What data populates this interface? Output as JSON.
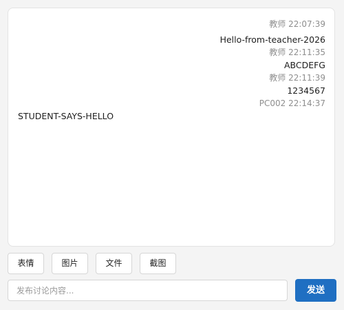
{
  "messages": [
    {
      "sender": "教师",
      "time": "22:07:39",
      "text": "Hello-from-teacher-2026"
    },
    {
      "sender": "教师",
      "time": "22:11:35",
      "text": "ABCDEFG"
    },
    {
      "sender": "教师",
      "time": "22:11:39",
      "text": "1234567"
    },
    {
      "sender": "PC002",
      "time": "22:14:37",
      "text": "STUDENT-SAYS-HELLO"
    }
  ],
  "toolbar": {
    "emoji_label": "表情",
    "image_label": "图片",
    "file_label": "文件",
    "screenshot_label": "截图"
  },
  "composer": {
    "placeholder": "发布讨论内容...",
    "value": "",
    "send_label": "发送"
  },
  "colors": {
    "send_button": "#1f6fc2",
    "meta_text": "#8e8e8e",
    "panel_background": "#ffffff",
    "page_background": "#f4f4f4"
  }
}
